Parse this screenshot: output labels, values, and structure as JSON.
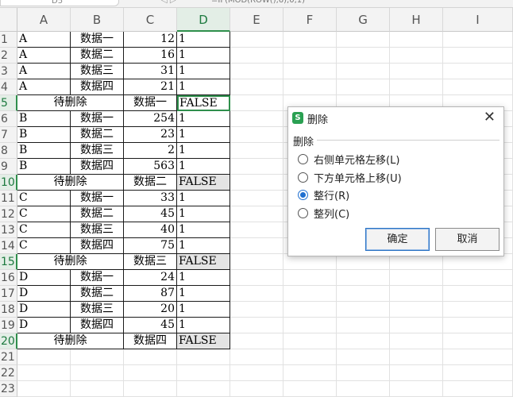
{
  "formula_bar": {
    "name_box": "D5",
    "arrow": "◁ ▷",
    "formula": "=IF(MOD(ROW(),6),0,1)"
  },
  "columns": [
    "A",
    "B",
    "C",
    "D",
    "E",
    "F",
    "G",
    "H",
    "I"
  ],
  "active_column": "D",
  "rows": [
    {
      "n": "1",
      "a": "A",
      "b": "数据一",
      "c": "12",
      "d": "1"
    },
    {
      "n": "2",
      "a": "A",
      "b": "数据二",
      "c": "16",
      "d": "1"
    },
    {
      "n": "3",
      "a": "A",
      "b": "数据三",
      "c": "31",
      "d": "1"
    },
    {
      "n": "4",
      "a": "A",
      "b": "数据四",
      "c": "21",
      "d": "1"
    },
    {
      "n": "5",
      "merged": "待删除",
      "c": "数据一",
      "d": "FALSE"
    },
    {
      "n": "6",
      "a": "B",
      "b": "数据一",
      "c": "254",
      "d": "1"
    },
    {
      "n": "7",
      "a": "B",
      "b": "数据二",
      "c": "23",
      "d": "1"
    },
    {
      "n": "8",
      "a": "B",
      "b": "数据三",
      "c": "2",
      "d": "1"
    },
    {
      "n": "9",
      "a": "B",
      "b": "数据四",
      "c": "563",
      "d": "1"
    },
    {
      "n": "10",
      "merged": "待删除",
      "c": "数据二",
      "d": "FALSE"
    },
    {
      "n": "11",
      "a": "C",
      "b": "数据一",
      "c": "33",
      "d": "1"
    },
    {
      "n": "12",
      "a": "C",
      "b": "数据二",
      "c": "45",
      "d": "1"
    },
    {
      "n": "13",
      "a": "C",
      "b": "数据三",
      "c": "40",
      "d": "1"
    },
    {
      "n": "14",
      "a": "C",
      "b": "数据四",
      "c": "75",
      "d": "1"
    },
    {
      "n": "15",
      "merged": "待删除",
      "c": "数据三",
      "d": "FALSE"
    },
    {
      "n": "16",
      "a": "D",
      "b": "数据一",
      "c": "24",
      "d": "1"
    },
    {
      "n": "17",
      "a": "D",
      "b": "数据二",
      "c": "87",
      "d": "1"
    },
    {
      "n": "18",
      "a": "D",
      "b": "数据三",
      "c": "20",
      "d": "1"
    },
    {
      "n": "19",
      "a": "D",
      "b": "数据四",
      "c": "45",
      "d": "1"
    },
    {
      "n": "20",
      "merged": "待删除",
      "c": "数据四",
      "d": "FALSE"
    },
    {
      "n": "21"
    },
    {
      "n": "22"
    },
    {
      "n": "23"
    }
  ],
  "active_rows": [
    "5",
    "10",
    "15",
    "20"
  ],
  "dialog": {
    "title": "删除",
    "logo": "S",
    "group_label": "删除",
    "options": [
      {
        "label": "右侧单元格左移(L)",
        "checked": false
      },
      {
        "label": "下方单元格上移(U)",
        "checked": false
      },
      {
        "label": "整行(R)",
        "checked": true
      },
      {
        "label": "整列(C)",
        "checked": false
      }
    ],
    "ok_label": "确定",
    "cancel_label": "取消",
    "close_glyph": "✕"
  },
  "colors": {
    "accent_green": "#2f8f4c",
    "radio_blue": "#1f6fd0",
    "false_cell_gray": "#e4e4e4"
  }
}
